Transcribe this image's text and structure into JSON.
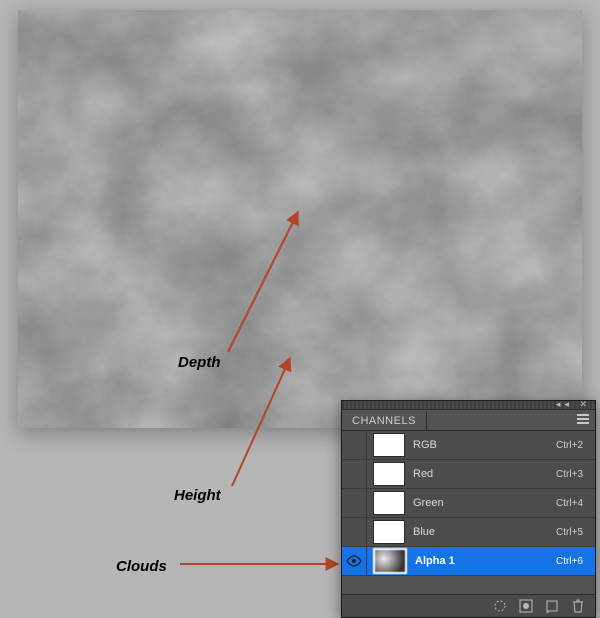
{
  "annotations": {
    "depth": "Depth",
    "height": "Height",
    "clouds": "Clouds"
  },
  "panel": {
    "tab": "CHANNELS",
    "collapse": "◂◂",
    "close": "✕",
    "channels": [
      {
        "name": "RGB",
        "shortcut": "Ctrl+2",
        "selected": false,
        "visible": false,
        "alpha": false
      },
      {
        "name": "Red",
        "shortcut": "Ctrl+3",
        "selected": false,
        "visible": false,
        "alpha": false
      },
      {
        "name": "Green",
        "shortcut": "Ctrl+4",
        "selected": false,
        "visible": false,
        "alpha": false
      },
      {
        "name": "Blue",
        "shortcut": "Ctrl+5",
        "selected": false,
        "visible": false,
        "alpha": false
      },
      {
        "name": "Alpha 1",
        "shortcut": "Ctrl+6",
        "selected": true,
        "visible": true,
        "alpha": true
      }
    ],
    "footer_icons": [
      "load-selection-icon",
      "save-mask-icon",
      "new-channel-icon",
      "delete-channel-icon"
    ]
  }
}
